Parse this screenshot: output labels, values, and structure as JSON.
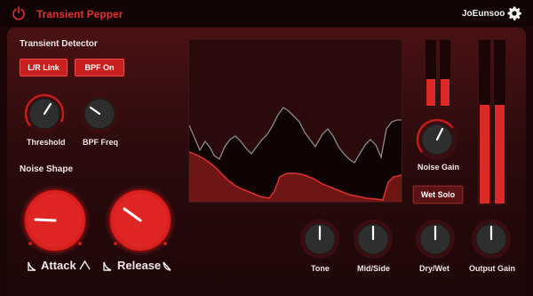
{
  "app": {
    "title": "Transient Pepper",
    "user": "JoEunsoo"
  },
  "colors": {
    "accent": "#e0312f",
    "panel": "#3a0e10",
    "knob_dark": "#3b3b3b",
    "knob_red": "#d8201f"
  },
  "transient_detector": {
    "heading": "Transient Detector",
    "buttons": {
      "lr_link": "L/R Link",
      "bpf_on": "BPF On"
    },
    "knobs": {
      "threshold": "Threshold",
      "bpf_freq": "BPF Freq"
    }
  },
  "noise_shape": {
    "heading": "Noise Shape",
    "attack": "Attack",
    "release": "Release"
  },
  "right_controls": {
    "noise_gain": "Noise Gain",
    "wet_solo": "Wet Solo",
    "tone": "Tone",
    "mid_side": "Mid/Side",
    "dry_wet": "Dry/Wet",
    "output_gain": "Output Gain"
  },
  "meters": {
    "noise_left_level": 0.4,
    "noise_right_level": 0.4,
    "output_left_level": 0.6,
    "output_right_level": 0.6
  },
  "icons": [
    "power-icon",
    "gear-icon",
    "attack-shape-icon",
    "release-shape-icon"
  ]
}
